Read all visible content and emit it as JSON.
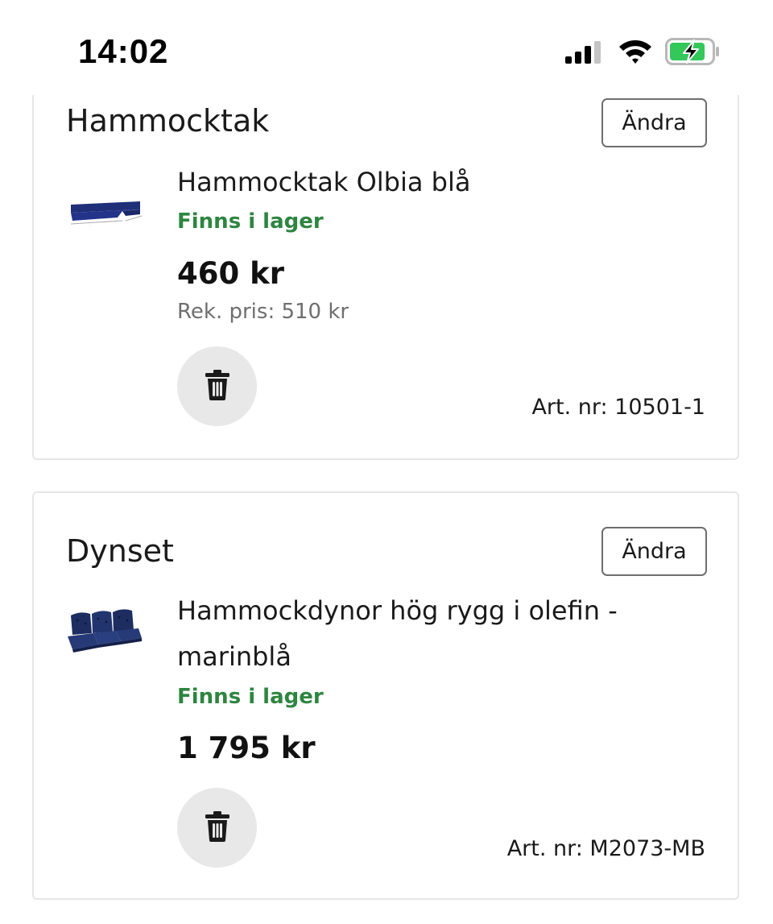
{
  "status_bar": {
    "time": "14:02",
    "icons": [
      "cellular-signal-icon",
      "wifi-icon",
      "battery-charging-icon"
    ]
  },
  "sections": [
    {
      "title": "Hammocktak",
      "change_label": "Ändra",
      "product": {
        "name": "Hammocktak Olbia blå",
        "stock": "Finns i lager",
        "price": "460 kr",
        "rec_price": "Rek. pris: 510 kr",
        "art_nr": "Art. nr: 10501-1",
        "image": "hammock-canopy-thumbnail"
      }
    },
    {
      "title": "Dynset",
      "change_label": "Ändra",
      "product": {
        "name": "Hammockdynor hög rygg i olefin - marinblå",
        "stock": "Finns i lager",
        "price": "1 795 kr",
        "art_nr": "Art. nr: M2073-MB",
        "image": "cushion-set-thumbnail"
      }
    }
  ],
  "colors": {
    "in_stock": "#2e8540",
    "muted_text": "#6f6f6f",
    "delete_bg": "#e8e8e8",
    "card_border": "#e6e6e6",
    "battery_charge": "#34c759"
  }
}
